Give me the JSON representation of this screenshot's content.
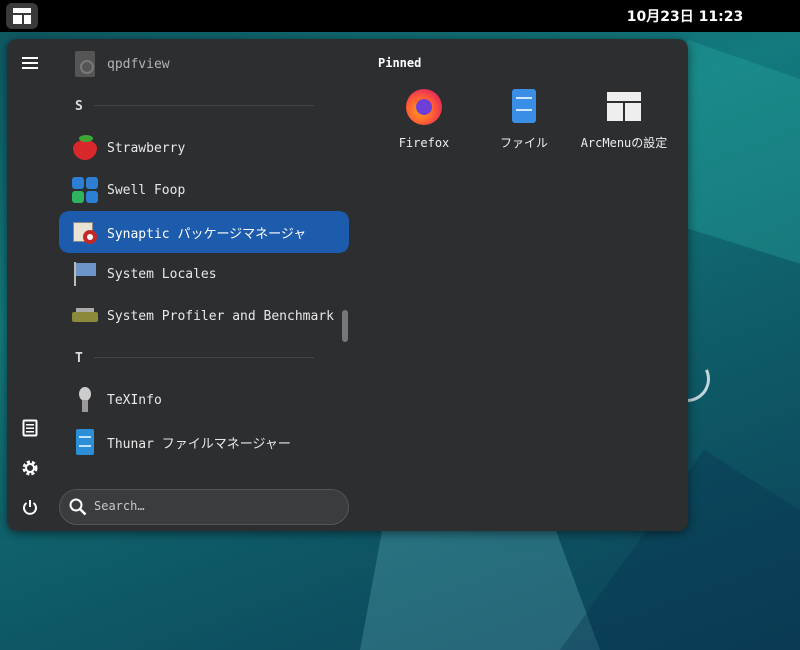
{
  "topbar": {
    "clock": "10月23日  11:23"
  },
  "sidebar": {
    "items": [
      {
        "icon": "hamburger-icon"
      },
      {
        "icon": "document-icon"
      },
      {
        "icon": "gear-icon"
      },
      {
        "icon": "power-icon"
      }
    ]
  },
  "applist": {
    "items": [
      {
        "label": "qpdfview",
        "icon": "pdf-viewer-icon"
      },
      {
        "label": "Strawberry",
        "icon": "strawberry-icon"
      },
      {
        "label": "Swell Foop",
        "icon": "swell-foop-icon"
      },
      {
        "label": "Synaptic パッケージマネージャ",
        "icon": "synaptic-icon",
        "selected": true
      },
      {
        "label": "System Locales",
        "icon": "locales-icon"
      },
      {
        "label": "System Profiler and Benchmark",
        "icon": "profiler-icon"
      },
      {
        "label": "TeXInfo",
        "icon": "texinfo-icon"
      },
      {
        "label": "Thunar ファイルマネージャー",
        "icon": "thunar-icon"
      }
    ],
    "sections": [
      "S",
      "T"
    ]
  },
  "search": {
    "placeholder": "Search…"
  },
  "pinned": {
    "title": "Pinned",
    "items": [
      {
        "label": "Firefox",
        "icon": "firefox-icon"
      },
      {
        "label": "ファイル",
        "icon": "files-icon"
      },
      {
        "label": "ArcMenuの設定",
        "icon": "arcmenu-settings-icon"
      }
    ]
  },
  "colors": {
    "selection": "#1d5bac",
    "panel": "#2d2e30",
    "topbar": "#000000"
  }
}
